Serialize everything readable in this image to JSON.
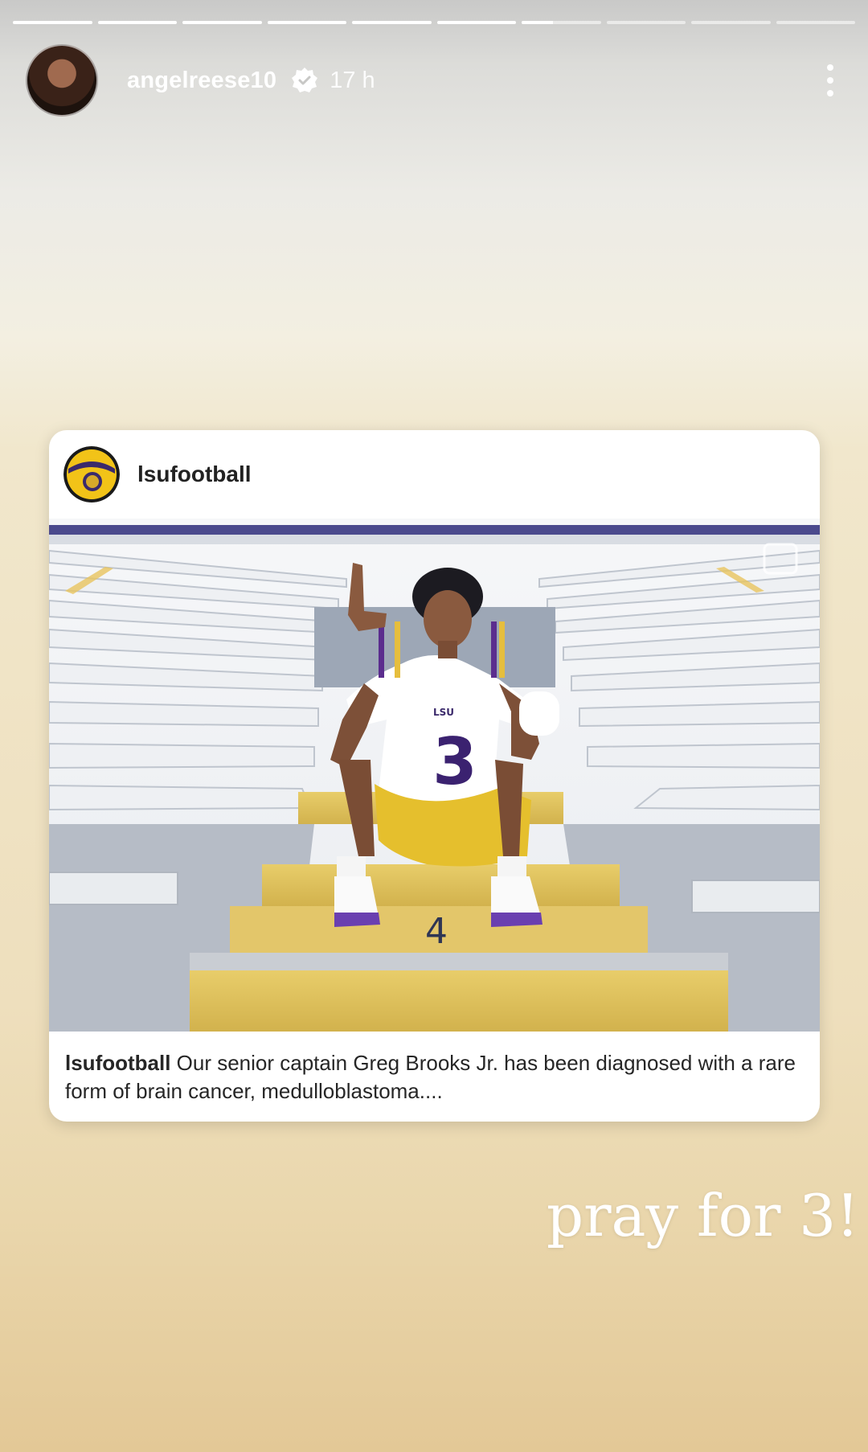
{
  "story": {
    "username": "angelreese10",
    "time_ago": "17 h",
    "progress_segments": [
      {
        "fill": 1
      },
      {
        "fill": 1
      },
      {
        "fill": 1
      },
      {
        "fill": 1
      },
      {
        "fill": 1
      },
      {
        "fill": 1
      },
      {
        "fill": 0.4
      },
      {
        "fill": 0
      },
      {
        "fill": 0
      },
      {
        "fill": 0
      }
    ]
  },
  "shared_post": {
    "username": "lsufootball",
    "caption_user": "lsufootball",
    "caption_text": " Our senior captain Greg Brooks Jr. has been diagnosed with a rare form of brain cancer, medulloblastoma....",
    "photo": {
      "jersey_number": "3",
      "jersey_text": "LSU",
      "step_number": "4"
    }
  },
  "sticker_text": "pray for 3!",
  "icons": {
    "verified": "verified-badge-icon",
    "more": "more-options-icon"
  }
}
